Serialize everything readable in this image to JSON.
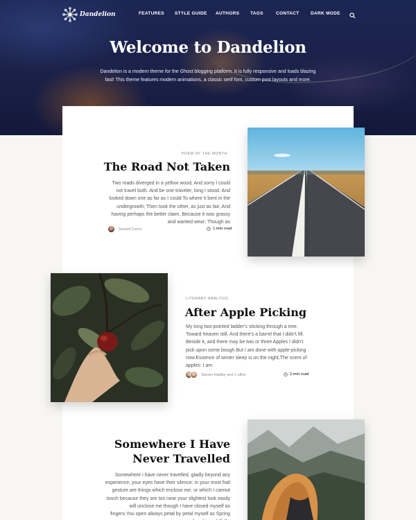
{
  "site": {
    "logo_text": "Dandelion"
  },
  "nav": {
    "items": [
      "FEATURES",
      "STYLE GUIDE",
      "AUTHORS",
      "TAGS",
      "CONTACT",
      "DARK MODE"
    ],
    "search_icon": "search-icon"
  },
  "hero": {
    "title": "Welcome to Dandelion",
    "description": "Dandelion is a modern theme for the Ghost blogging platform. It is fully responsive and loads blazing fast! This theme features modern animations, a classic serif font, custom post layouts and more."
  },
  "posts": [
    {
      "kicker": "POEM OF THE MONTH",
      "title": "The Road Not Taken",
      "excerpt": "Two roads diverged in a yellow wood, And sorry I could not travel both. And be one traveler, long I stood. And looked down one as far as I could To where it bent in the undergrowth; Then took the other, as just as fair, And having perhaps the better claim, Because it was grassy and wanted wear; Though as",
      "author": "Gerard Caron",
      "read_time": "1 min read"
    },
    {
      "kicker": "LITERARY ANALYSIS",
      "title": "After Apple Picking",
      "excerpt": "My long two-pointed ladder's sticking through a tree. Toward heaven still, And there's a barrel that I didn't fill. Beside it, and there may be two or three Apples I didn't pick upon some bough.But I am done with apple-picking now.Essence of winter sleep is on the night,The scent of apples: I am",
      "author": "Steven Hadley and 1 other",
      "read_time": "2 min read"
    },
    {
      "title_line1": "Somewhere I Have",
      "title_line2": "Never Travelled",
      "excerpt": "Somewhere i have never travelled, gladly beyond any experience, your eyes have their silence: in your most frail gesture are things which enclose me, or which I cannot touch because they are too near your slightest look easily will unclose me though I have closed myself as fingers.You open always petal by petal myself as Spring opens(touching skilfully,"
    }
  ]
}
